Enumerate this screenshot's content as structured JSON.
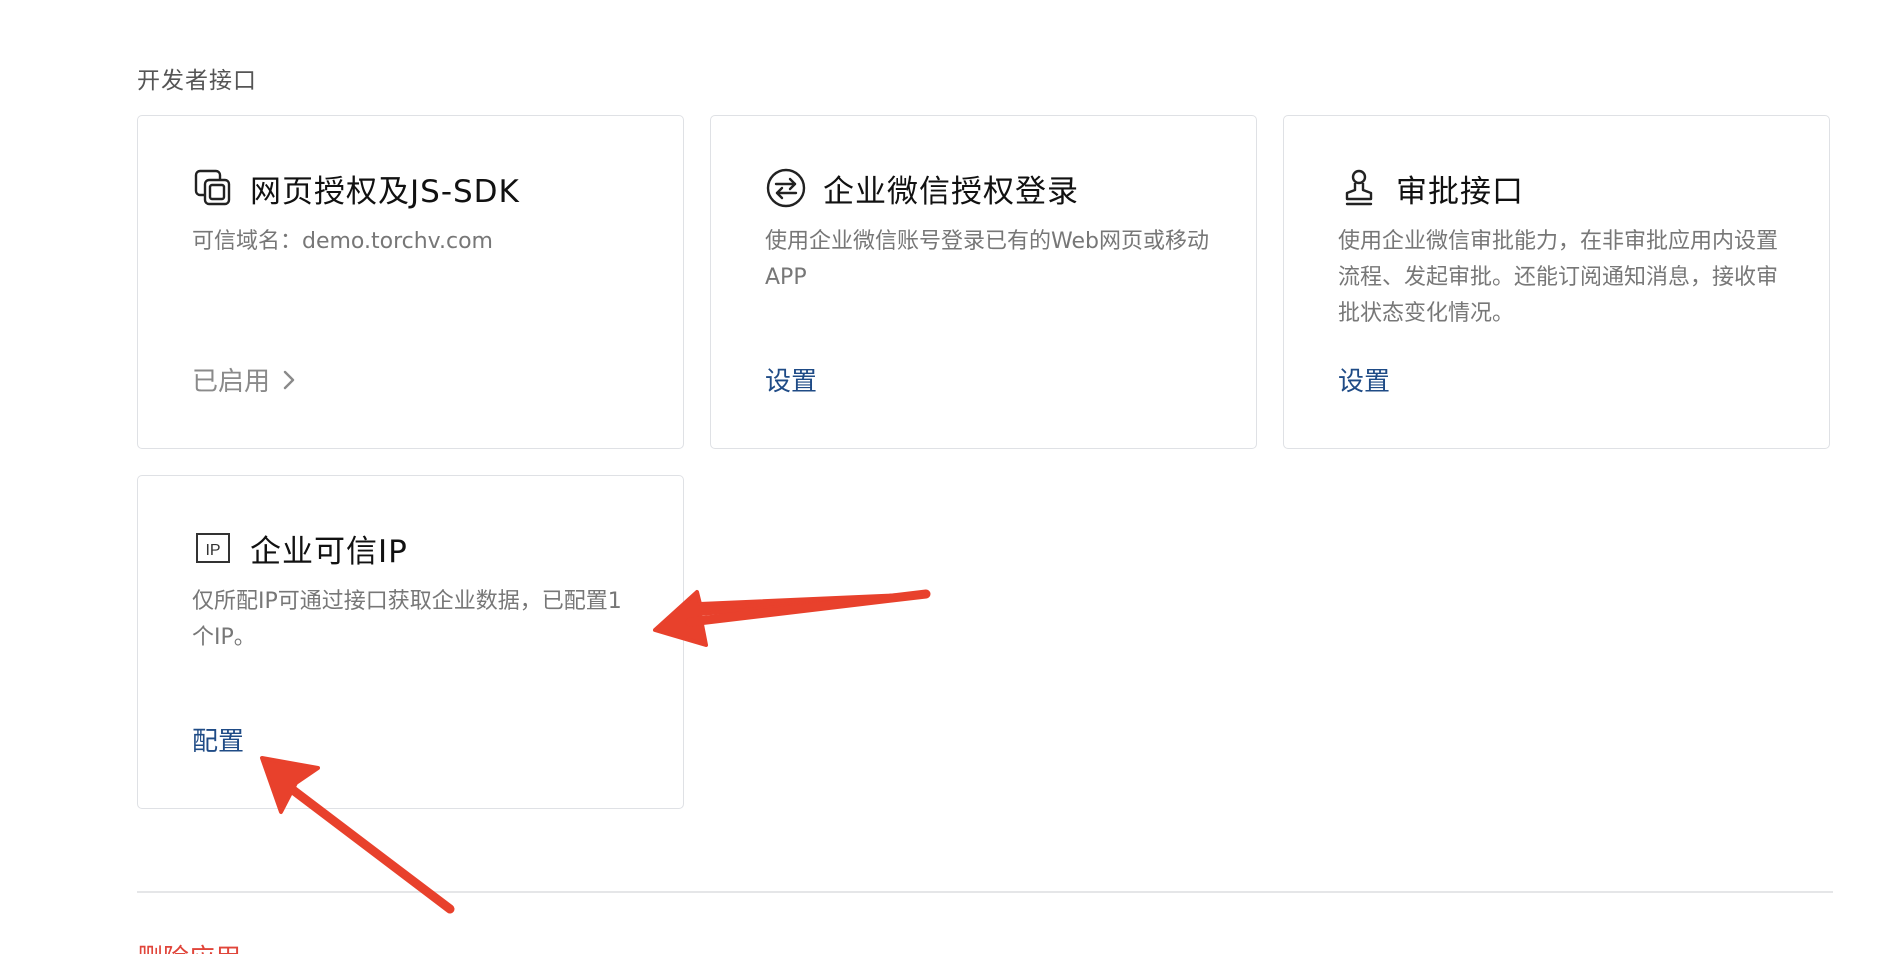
{
  "section": {
    "title": "开发者接口"
  },
  "cards": [
    {
      "title": "网页授权及JS-SDK",
      "icon": "window-stack-icon",
      "description": "可信域名：demo.torchv.com",
      "action": "已启用"
    },
    {
      "title": "企业微信授权登录",
      "icon": "swap-arrows-icon",
      "description": "使用企业微信账号登录已有的Web网页或移动APP",
      "action": "设置"
    },
    {
      "title": "审批接口",
      "icon": "stamp-icon",
      "description": "使用企业微信审批能力，在非审批应用内设置流程、发起审批。还能订阅通知消息，接收审批状态变化情况。",
      "action": "设置"
    },
    {
      "title": "企业可信IP",
      "icon": "ip-icon",
      "description": "仅所配IP可通过接口获取企业数据，已配置1个IP。",
      "action": "配置"
    }
  ],
  "footer": {
    "danger_label": "删除应用"
  },
  "colors": {
    "link": "#1f4b86",
    "muted": "#8a8a8a",
    "danger": "#e0453a",
    "annotation_arrow": "#e8412c"
  }
}
